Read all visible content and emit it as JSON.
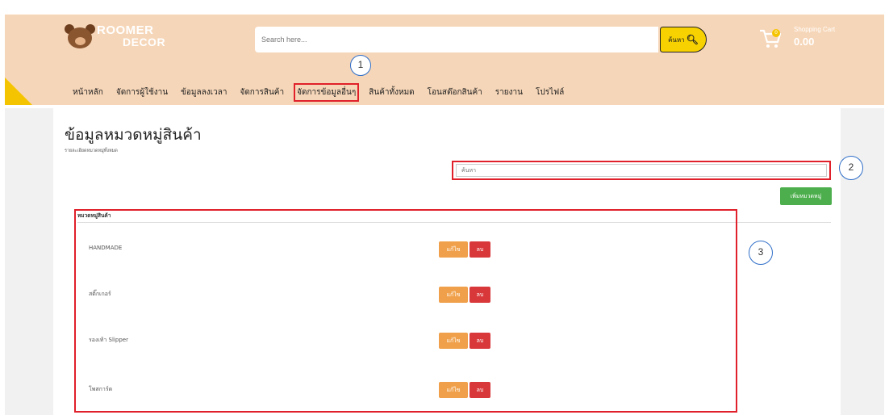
{
  "brand": {
    "line1": "ROOMER",
    "line2": "DECOR"
  },
  "search": {
    "placeholder": "Search here...",
    "button_label": "ค้นหา"
  },
  "cart": {
    "label": "Shopping Cart",
    "amount": "0.00",
    "count": "0"
  },
  "nav": {
    "items": [
      {
        "label": "หน้าหลัก"
      },
      {
        "label": "จัดการผู้ใช้งาน"
      },
      {
        "label": "ข้อมูลลงเวลา"
      },
      {
        "label": "จัดการสินค้า"
      },
      {
        "label": "จัดการข้อมูลอื่นๆ",
        "highlighted": true
      },
      {
        "label": "สินค้าทั้งหมด"
      },
      {
        "label": "โอนสต๊อกสินค้า"
      },
      {
        "label": "รายงาน"
      },
      {
        "label": "โปรไฟล์"
      }
    ]
  },
  "callouts": {
    "c1": "1",
    "c2": "2",
    "c3": "3"
  },
  "content": {
    "title": "ข้อมูลหมวดหมู่สินค้า",
    "subtitle": "รายละเอียดหมวดหมู่ทั้งหมด",
    "search_placeholder": "ค้นหา",
    "add_label": "เพิ่มหมวดหมู่",
    "column_header": "หมวดหมู่สินค้า",
    "edit_label": "แก้ไข",
    "delete_label": "ลบ",
    "rows": [
      {
        "name": "HANDMADE"
      },
      {
        "name": "สติ๊กเกอร์"
      },
      {
        "name": "รองเท้า Slipper"
      },
      {
        "name": "โพสการ์ด"
      }
    ]
  },
  "colors": {
    "header_bg": "#f6d6b8",
    "accent_yellow": "#f7d100",
    "highlight_red": "#e0202a",
    "edit_orange": "#f0a04a",
    "delete_red": "#d9383a",
    "add_green": "#4cae4c",
    "callout_blue": "#2f6ec8"
  }
}
